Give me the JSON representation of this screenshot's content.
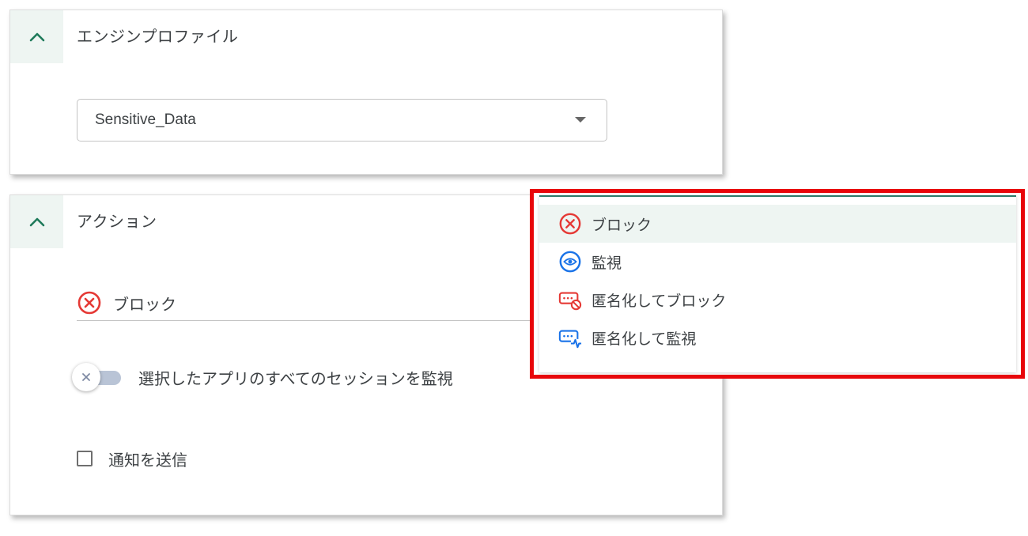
{
  "engine_profile": {
    "title": "エンジンプロファイル",
    "collapse_icon": "chevron-up-icon",
    "selected_value": "Sensitive_Data"
  },
  "action": {
    "title": "アクション",
    "collapse_icon": "chevron-up-icon",
    "selected_action": "ブロック",
    "selected_action_icon": "block-icon",
    "toggle_label": "選択したアプリのすべてのセッションを監視",
    "toggle_on": false,
    "checkbox_label": "通知を送信",
    "checkbox_checked": false
  },
  "dropdown": {
    "items": [
      {
        "label": "ブロック",
        "icon": "block-icon",
        "selected": true
      },
      {
        "label": "監視",
        "icon": "monitor-eye-icon",
        "selected": false
      },
      {
        "label": "匿名化してブロック",
        "icon": "anonymize-block-icon",
        "selected": false
      },
      {
        "label": "匿名化して監視",
        "icon": "anonymize-monitor-icon",
        "selected": false
      }
    ]
  },
  "colors": {
    "accent_green": "#1e7a5a",
    "header_bg": "#eef5f2",
    "block_red": "#e53935",
    "monitor_blue": "#1a73e8",
    "highlight_border": "#e8060a"
  }
}
